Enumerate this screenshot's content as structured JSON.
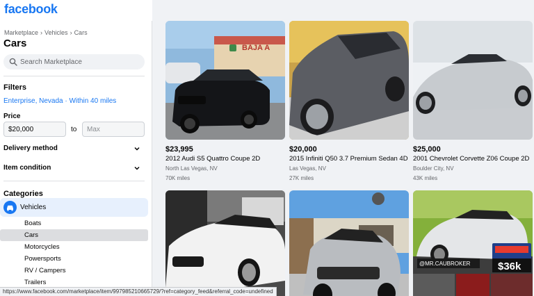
{
  "brand": {
    "logo_text": "facebook",
    "color": "#1877f2"
  },
  "sidebar": {
    "breadcrumb": [
      "Marketplace",
      "Vehicles",
      "Cars"
    ],
    "title": "Cars",
    "search_placeholder": "Search Marketplace",
    "filters_heading": "Filters",
    "location_filter": "Enterprise, Nevada · Within 40 miles",
    "price_label": "Price",
    "price_min": "$20,000",
    "price_to": "to",
    "price_max_placeholder": "Max",
    "delivery_method": "Delivery method",
    "item_condition": "Item condition",
    "categories_heading": "Categories",
    "active_category": "Vehicles",
    "subcategories": [
      "Boats",
      "Cars",
      "Motorcycles",
      "Powersports",
      "RV / Campers",
      "Trailers"
    ],
    "selected_subcategory": "Cars"
  },
  "listings": [
    {
      "price": "$23,995",
      "title": "2012 Audi S5 Quattro Coupe 2D",
      "location": "North Las Vegas, NV",
      "miles": "70K miles"
    },
    {
      "price": "$20,000",
      "title": "2015 Infiniti Q50 3.7 Premium Sedan 4D",
      "location": "Las Vegas, NV",
      "miles": "27K miles"
    },
    {
      "price": "$25,000",
      "title": "2001 Chevrolet Corvette Z06 Coupe 2D",
      "location": "Boulder City, NV",
      "miles": "43K miles"
    },
    {
      "price": "",
      "title": "",
      "location": "",
      "miles": ""
    },
    {
      "price": "",
      "title": "",
      "location": "",
      "miles": ""
    },
    {
      "price": "",
      "title": "",
      "location": "",
      "miles": ""
    }
  ],
  "photo_text": {
    "storefront_sign": "BAJA A",
    "watermark_handle": "@MR.CAUBROKER",
    "price_overlay": "$36k"
  },
  "status_url": "https://www.facebook.com/marketplace/item/997985210665729/?ref=category_feed&referral_code=undefined"
}
